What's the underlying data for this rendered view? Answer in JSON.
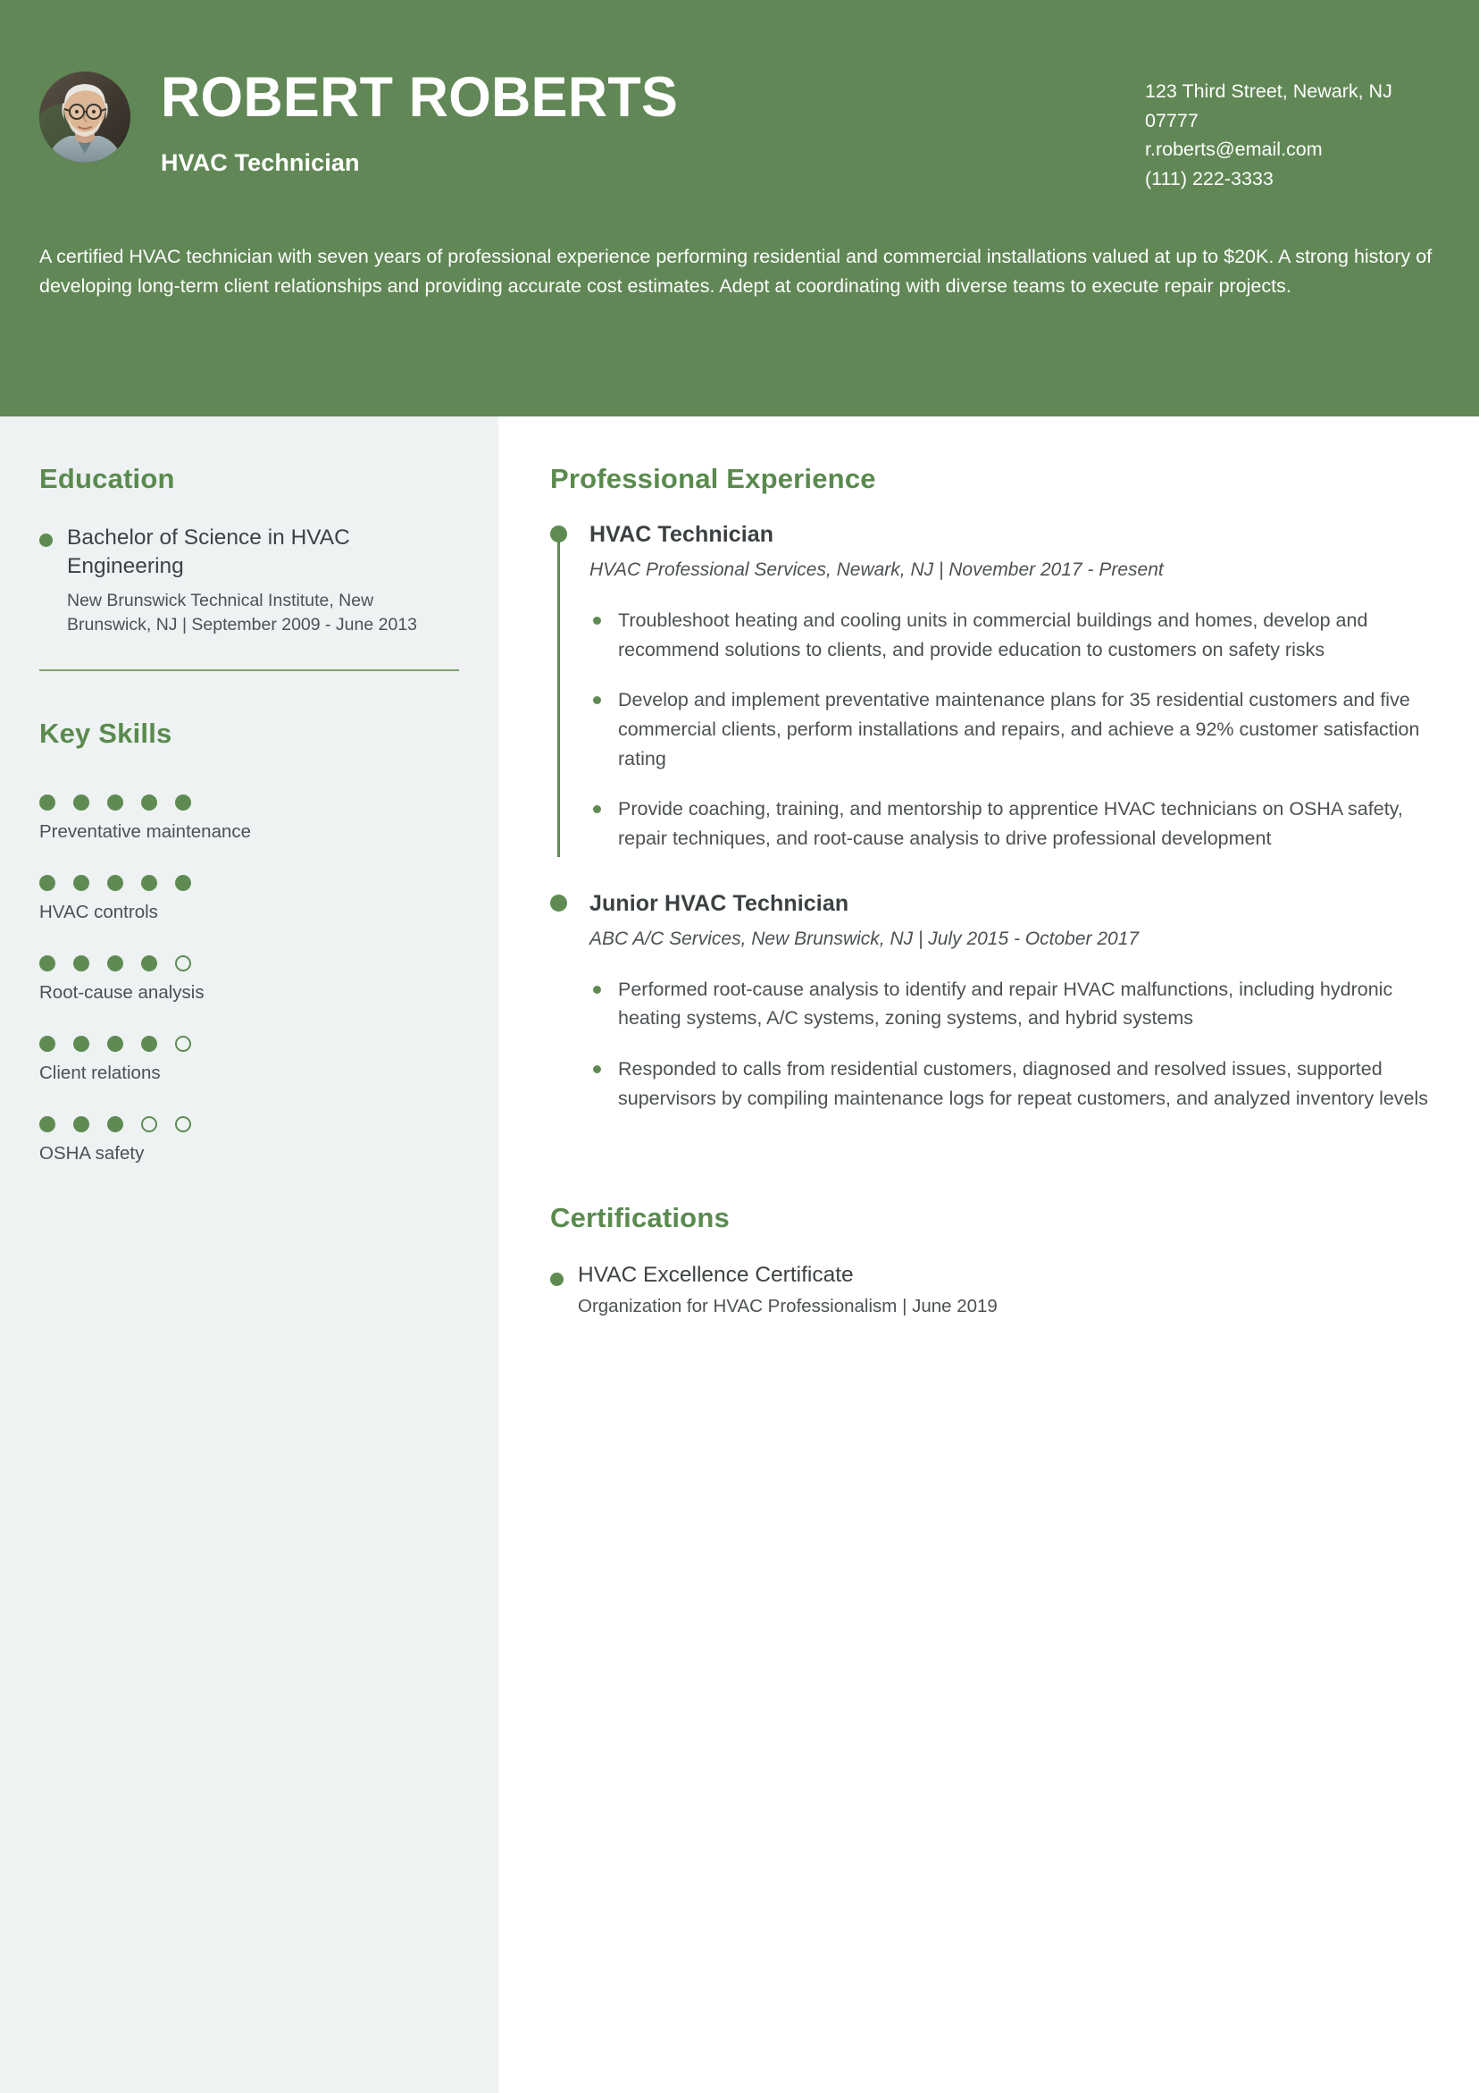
{
  "theme": {
    "header_bg": "#608755",
    "sidebar_bg": "#eef2f3",
    "accent_green": "#5f8b53",
    "heading_green": "#5a8a4e",
    "body_text": "#4c5154"
  },
  "header": {
    "name": "ROBERT ROBERTS",
    "job_title": "HVAC Technician",
    "contact": {
      "address_line1": "123 Third Street, Newark, NJ",
      "address_line2": "07777",
      "email": "r.roberts@email.com",
      "phone": "(111) 222-3333"
    },
    "summary": "A certified HVAC technician with seven years of professional experience performing residential and commercial installations valued at up to $20K. A strong history of developing long-term client relationships and providing accurate cost estimates. Adept at coordinating with diverse teams to execute repair projects."
  },
  "sidebar": {
    "education": {
      "heading": "Education",
      "items": [
        {
          "degree": "Bachelor of Science in HVAC Engineering",
          "meta": "New Brunswick Technical Institute, New Brunswick, NJ | September 2009 - June 2013"
        }
      ]
    },
    "key_skills": {
      "heading": "Key Skills",
      "max_rating": 5,
      "items": [
        {
          "label": "Preventative maintenance",
          "rating": 5
        },
        {
          "label": "HVAC controls",
          "rating": 5
        },
        {
          "label": "Root-cause analysis",
          "rating": 4
        },
        {
          "label": "Client relations",
          "rating": 4
        },
        {
          "label": "OSHA safety",
          "rating": 3
        }
      ]
    }
  },
  "main": {
    "experience": {
      "heading": "Professional Experience",
      "items": [
        {
          "role": "HVAC Technician",
          "meta": "HVAC Professional Services, Newark, NJ | November 2017 - Present",
          "bullets": [
            "Troubleshoot heating and cooling units in commercial buildings and homes, develop and recommend solutions to clients, and provide education to customers on safety risks",
            "Develop and implement preventative maintenance plans for 35 residential customers and five commercial clients, perform installations and repairs, and achieve a 92% customer satisfaction rating",
            "Provide coaching, training, and mentorship to apprentice HVAC technicians on OSHA safety, repair techniques, and root-cause analysis to drive professional development"
          ]
        },
        {
          "role": "Junior HVAC Technician",
          "meta": "ABC A/C Services, New Brunswick, NJ | July 2015 - October 2017",
          "bullets": [
            "Performed root-cause analysis to identify and repair HVAC malfunctions, including hydronic heating systems, A/C systems, zoning systems, and hybrid systems",
            "Responded to calls from residential customers, diagnosed and resolved issues, supported supervisors by compiling maintenance logs for repeat customers, and analyzed inventory levels"
          ]
        }
      ]
    },
    "certifications": {
      "heading": "Certifications",
      "items": [
        {
          "title": "HVAC Excellence Certificate",
          "meta": "Organization for HVAC Professionalism | June 2019"
        }
      ]
    }
  }
}
